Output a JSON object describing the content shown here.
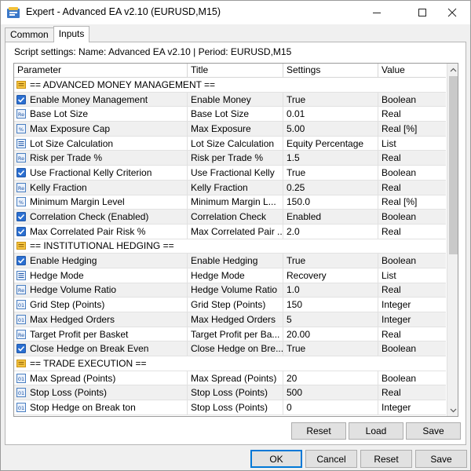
{
  "window": {
    "title": "Expert - Advanced EA v2.10 (EURUSD,M15)"
  },
  "tabs": [
    {
      "label": "Common"
    },
    {
      "label": "Inputs"
    }
  ],
  "script_settings": "Script settings: Name: Advanced EA v2.10 | Period: EURUSD,M15",
  "columns": {
    "parameter": "Parameter",
    "title": "Title",
    "settings": "Settings",
    "value": "Value"
  },
  "rows": [
    {
      "param": "== ADVANCED MONEY MANAGEMENT ==",
      "title": "",
      "setting": "",
      "value": "",
      "icon": "section-icon"
    },
    {
      "param": "Enable Money Management",
      "title": "Enable Money",
      "setting": "True",
      "value": "Boolean",
      "icon": "checkbox-icon"
    },
    {
      "param": "Base Lot Size",
      "title": "Base Lot Size",
      "setting": "0.01",
      "value": "Real",
      "icon": "real-icon"
    },
    {
      "param": "Max Exposure Cap",
      "title": "Max Exposure",
      "setting": "5.00",
      "value": "Real [%]",
      "icon": "percent-icon"
    },
    {
      "param": "Lot Size Calculation",
      "title": "Lot Size Calculation",
      "setting": "Equity Percentage",
      "value": "List",
      "icon": "list-icon"
    },
    {
      "param": "Risk per Trade %",
      "title": "Risk per Trade %",
      "setting": "1.5",
      "value": "Real",
      "icon": "real-icon"
    },
    {
      "param": "Use Fractional Kelly Criterion",
      "title": "Use Fractional Kelly",
      "setting": "True",
      "value": "Boolean",
      "icon": "checkbox-icon"
    },
    {
      "param": "Kelly Fraction",
      "title": "Kelly Fraction",
      "setting": "0.25",
      "value": "Real",
      "icon": "real-icon"
    },
    {
      "param": "Minimum Margin Level",
      "title": "Minimum Margin L...",
      "setting": "150.0",
      "value": "Real [%]",
      "icon": "percent-icon"
    },
    {
      "param": "Correlation Check (Enabled)",
      "title": "Correlation Check",
      "setting": "Enabled",
      "value": "Boolean",
      "icon": "checkbox-icon"
    },
    {
      "param": "Max Correlated Pair Risk %",
      "title": "Max Correlated Pair ...",
      "setting": "2.0",
      "value": "Real",
      "icon": "checkbox-icon"
    },
    {
      "param": "== INSTITUTIONAL HEDGING ==",
      "title": "",
      "setting": "",
      "value": "",
      "icon": "section-icon"
    },
    {
      "param": "Enable Hedging",
      "title": "Enable Hedging",
      "setting": "True",
      "value": "Boolean",
      "icon": "checkbox-icon"
    },
    {
      "param": "Hedge Mode",
      "title": "Hedge Mode",
      "setting": "Recovery",
      "value": "List",
      "icon": "list-icon"
    },
    {
      "param": "Hedge Volume Ratio",
      "title": "Hedge Volume Ratio",
      "setting": "1.0",
      "value": "Real",
      "icon": "real-icon"
    },
    {
      "param": "Grid Step (Points)",
      "title": "Grid Step (Points)",
      "setting": "150",
      "value": "Integer",
      "icon": "integer-icon"
    },
    {
      "param": "Max Hedged Orders",
      "title": "Max Hedged Orders",
      "setting": "5",
      "value": "Integer",
      "icon": "integer-icon"
    },
    {
      "param": "Target Profit per Basket",
      "title": "Target Profit per Ba...",
      "setting": "20.00",
      "value": "Real",
      "icon": "real-icon"
    },
    {
      "param": "Close Hedge on Break Even",
      "title": "Close Hedge on Bre...",
      "setting": "True",
      "value": "Boolean",
      "icon": "checkbox-icon"
    },
    {
      "param": "== TRADE EXECUTION ==",
      "title": "",
      "setting": "",
      "value": "",
      "icon": "section-icon"
    },
    {
      "param": "Max Spread (Points)",
      "title": "Max Spread (Points)",
      "setting": "20",
      "value": "Boolean",
      "icon": "integer-icon"
    },
    {
      "param": "Stop Loss (Points)",
      "title": "Stop Loss (Points)",
      "setting": "500",
      "value": "Real",
      "icon": "integer-icon"
    },
    {
      "param": "Stop Hedge on Break ton",
      "title": "Stop Loss (Points)",
      "setting": "0",
      "value": "Integer",
      "icon": "integer-icon"
    }
  ],
  "panel_buttons": {
    "reset": "Reset",
    "load": "Load",
    "save": "Save"
  },
  "dialog_buttons": {
    "ok": "OK",
    "cancel": "Cancel",
    "reset": "Reset",
    "save": "Save"
  },
  "colors": {
    "accent": "#0078d7",
    "section_icon": "#e8b21d",
    "checkbox": "#2b6fd1",
    "alt_row": "#f0f0f0"
  }
}
